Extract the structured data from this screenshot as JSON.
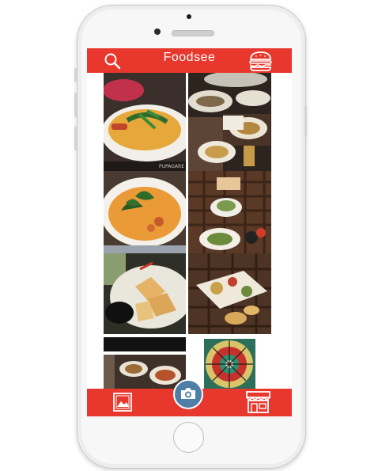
{
  "app": {
    "name": "Foodsee",
    "brand_color": "#e8382e",
    "fab_color": "#4f7fa6"
  },
  "top_bar": {
    "left_icon": "search-icon",
    "right_icon": "burger-icon"
  },
  "bottom_bar": {
    "left_icon": "gallery-icon",
    "center_icon": "camera-icon",
    "right_icon": "store-icon"
  },
  "feed": {
    "photos": [
      {
        "id": "curry-bowl",
        "watermark": "PUPAGARE"
      },
      {
        "id": "curry-basil"
      },
      {
        "id": "wontons"
      },
      {
        "id": "dark-tile"
      },
      {
        "id": "platter-top"
      },
      {
        "id": "platter-table"
      },
      {
        "id": "mixed-dishes"
      },
      {
        "id": "skewers"
      },
      {
        "id": "tapas-board"
      },
      {
        "id": "stained-glass"
      }
    ]
  }
}
